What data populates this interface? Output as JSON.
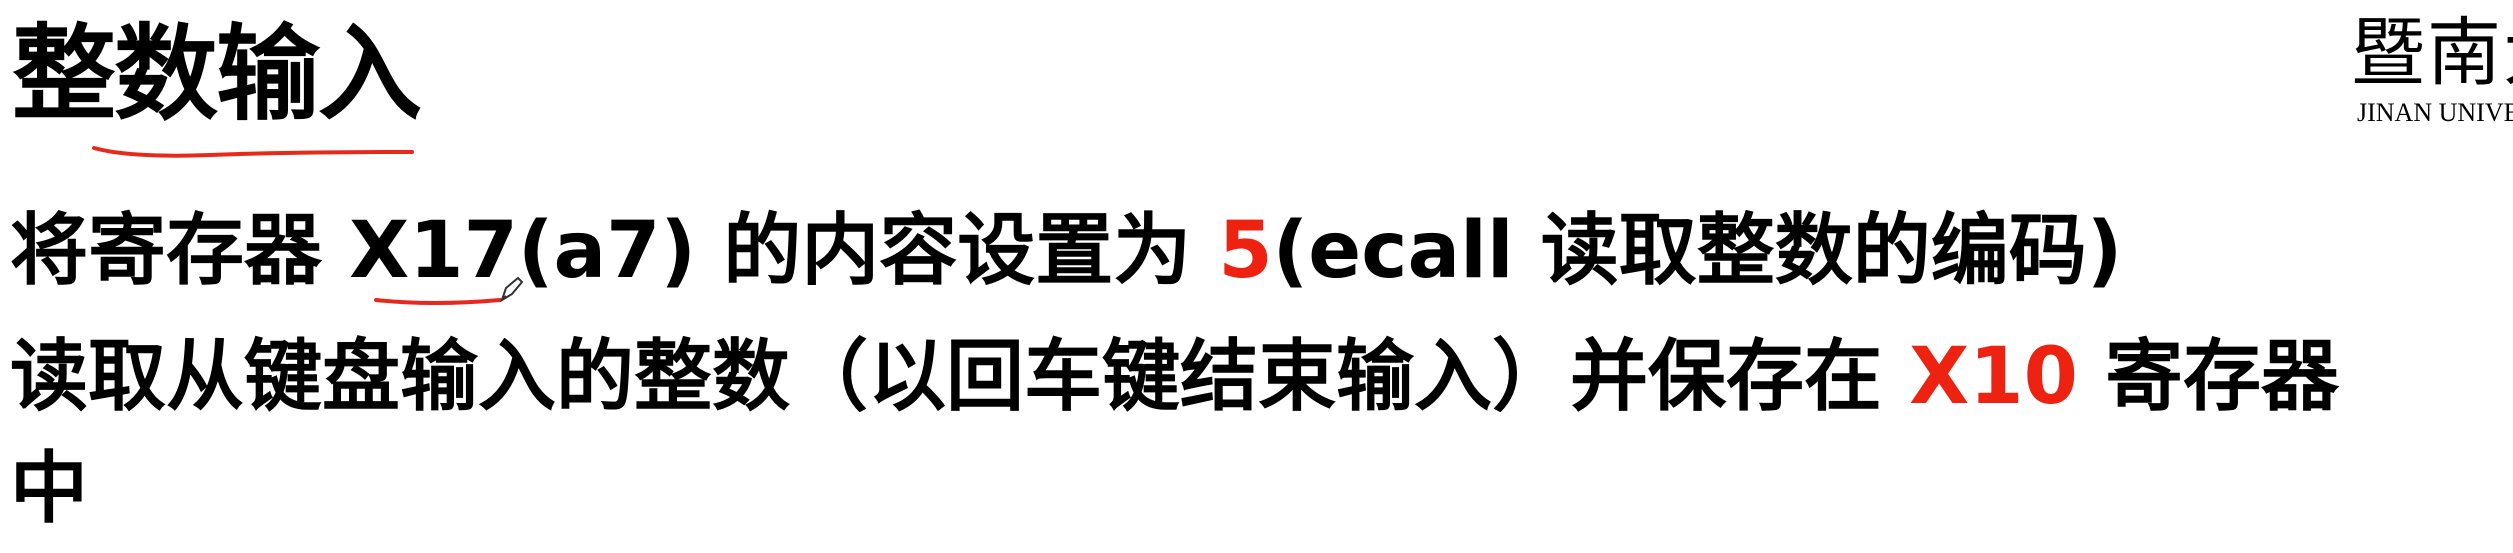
{
  "slide": {
    "title": "整数输入",
    "logo": {
      "chinese": "暨南大学",
      "english": "JINAN UNIVERSITY"
    },
    "line1": {
      "prefix": "将寄存器 ",
      "register": "X17",
      "abi": "(a7)",
      "middle": " 的内容设置为 ",
      "value": "5",
      "suffix": "(ecall 读取整数的编码)"
    },
    "line2": {
      "prefix": "读取从键盘输入的整数（以回车键结束输入）并保存在 ",
      "register": "X10",
      "suffix": " 寄存器"
    },
    "line3": {
      "text": "中"
    }
  },
  "colors": {
    "highlight": "#ee2211",
    "text": "#000000",
    "annotation": "#e8281a"
  }
}
